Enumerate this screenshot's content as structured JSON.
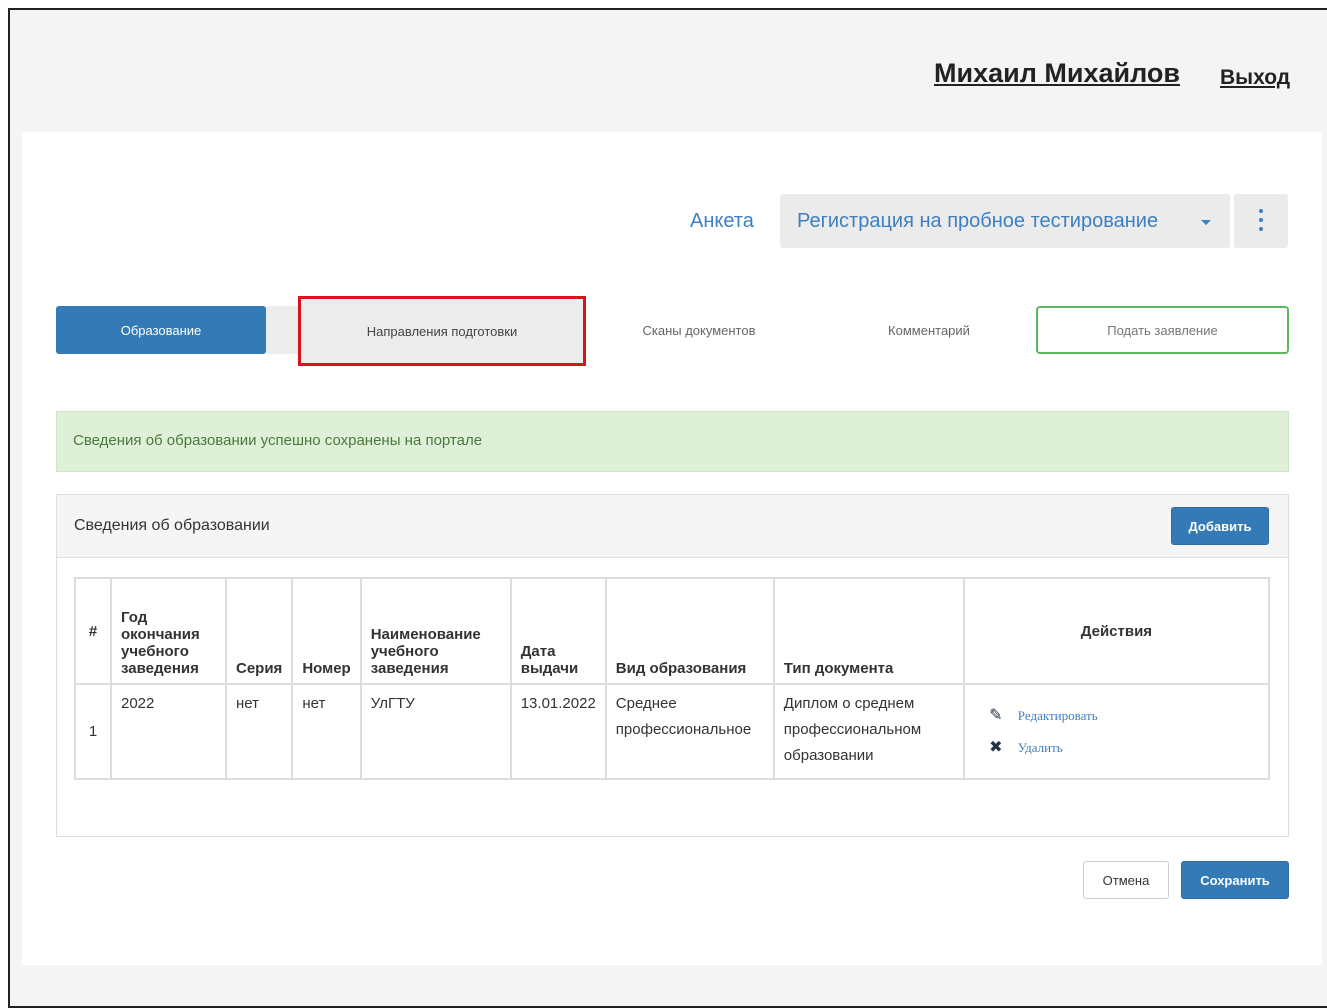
{
  "header": {
    "user_name": "Михаил Михайлов",
    "logout_label": "Выход"
  },
  "form": {
    "anketa_label": "Анкета",
    "campaign_selected": "Регистрация на пробное тестирование"
  },
  "tabs": [
    {
      "label": "Образование"
    },
    {
      "label": "Направления подготовки"
    },
    {
      "label": "Сканы документов"
    },
    {
      "label": "Комментарий"
    },
    {
      "label": "Подать заявление"
    }
  ],
  "alert": {
    "text": "Сведения об образовании успешно сохранены на портале"
  },
  "education": {
    "title": "Сведения об образовании",
    "add_label": "Добавить",
    "columns": [
      "#",
      "Год окончания учебного заведения",
      "Серия",
      "Номер",
      "Наименование учебного заведения",
      "Дата выдачи",
      "Вид образования",
      "Тип документа",
      "Действия"
    ],
    "rows": [
      {
        "num": "1",
        "year": "2022",
        "series": "нет",
        "number": "нет",
        "institution": "УлГТУ",
        "date": "13.01.2022",
        "edu_type": "Среднее профессиональное",
        "doc_type": "Диплом о среднем профессиональном образовании",
        "edit_label": "Редактировать",
        "delete_label": "Удалить"
      }
    ]
  },
  "footer": {
    "cancel_label": "Отмена",
    "save_label": "Сохранить"
  },
  "colors": {
    "primary": "#337ab7",
    "success_border": "#5cb85c",
    "alert_bg": "#dff0d8",
    "highlight": "#d9141f",
    "link": "#3d7fc1"
  },
  "icons": {
    "menu": "vertical-dots-icon",
    "edit": "pencil-icon",
    "delete": "close-icon"
  }
}
